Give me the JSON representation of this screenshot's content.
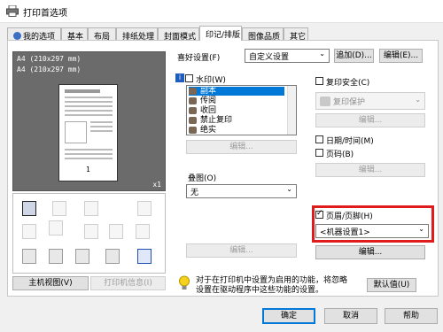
{
  "window": {
    "title": "打印首选项"
  },
  "tabs": [
    {
      "label": "我的选项",
      "active": false
    },
    {
      "label": "基本",
      "active": false
    },
    {
      "label": "布局",
      "active": false
    },
    {
      "label": "排纸处理",
      "active": false
    },
    {
      "label": "封面模式",
      "active": false
    },
    {
      "label": "印记/排版",
      "active": true
    },
    {
      "label": "图像品质",
      "active": false
    },
    {
      "label": "其它",
      "active": false
    }
  ],
  "preview": {
    "line1": "A4 (210x297 mm)",
    "line2": "A4 (210x297 mm)",
    "zoom": "x1",
    "page_number": "1"
  },
  "left_buttons": {
    "main_view": "主机视图(V)",
    "printer_info": "打印机信息(I)"
  },
  "favorites": {
    "label": "喜好设置(F)",
    "value": "自定义设置",
    "add": "追加(D)...",
    "edit": "编辑(E)..."
  },
  "watermark": {
    "label": "水印(W)",
    "checked": false,
    "items": [
      "副本",
      "传阅",
      "收回",
      "禁止复印",
      "绝实"
    ],
    "selected_index": 0,
    "edit": "编辑..."
  },
  "overlay": {
    "label": "叠图(O)",
    "value": "无",
    "edit": "编辑..."
  },
  "copy_security": {
    "label": "复印安全(C)",
    "checked": false,
    "value": "复印保护",
    "edit": "编辑..."
  },
  "datetime": {
    "label": "日期/时间(M)",
    "checked": false
  },
  "page_number": {
    "label": "页码(B)",
    "checked": false,
    "edit": "编辑..."
  },
  "header_footer": {
    "label": "页眉/页脚(H)",
    "checked": true,
    "value": "<机器设置1>",
    "edit": "编辑..."
  },
  "info": {
    "text_line1": "对于在打印机中设置为启用的功能，将忽略",
    "text_line2": "设置在驱动程序中这些功能的设置。"
  },
  "default_button": "默认值(U)",
  "footer": {
    "ok": "确定",
    "cancel": "取消",
    "help": "帮助"
  },
  "colors": {
    "highlight_border": "#e01b1b",
    "selection": "#0078d7"
  }
}
